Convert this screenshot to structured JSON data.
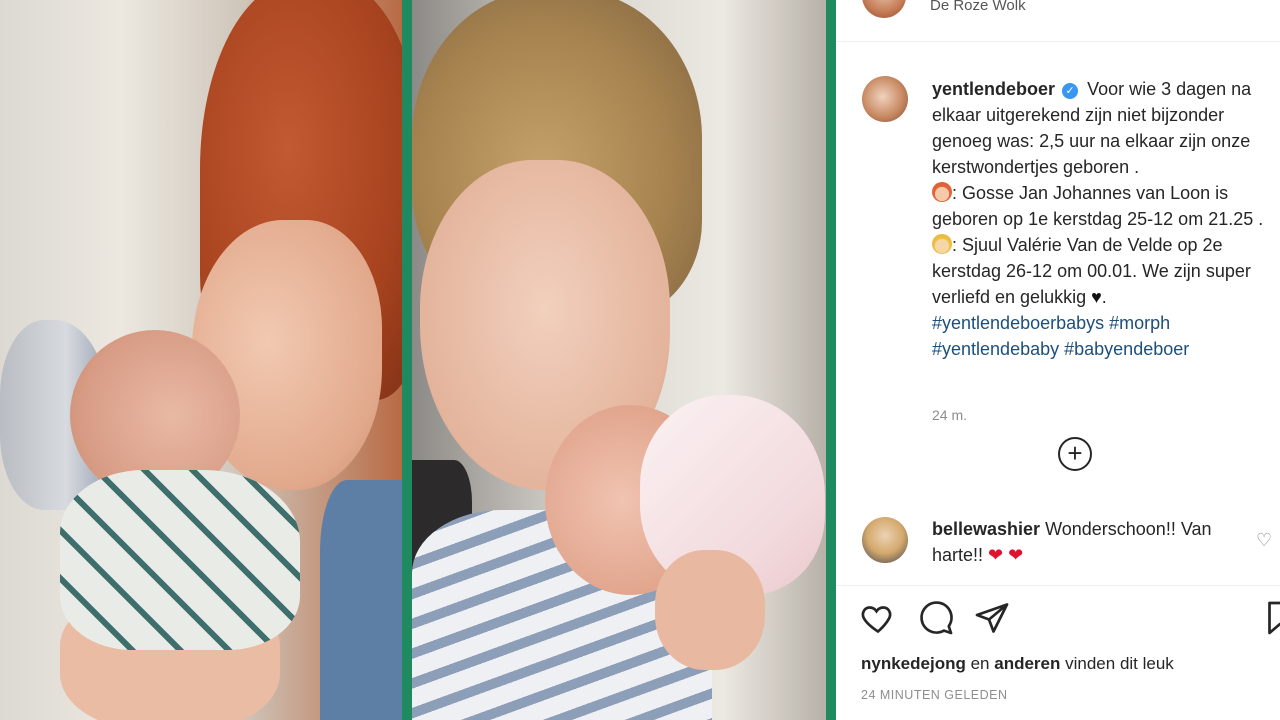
{
  "post": {
    "location": "De Roze Wolk",
    "author": "yentlendeboer",
    "caption_line1": "Voor wie 3 dagen na elkaar uitgerekend zijn niet bijzonder genoeg was: 2,5 uur na elkaar zijn onze kerstwondertjes geboren .",
    "caption_line2": ": Gosse Jan Johannes van Loon is geboren op 1e kerstdag 25-12 om 21.25 .",
    "caption_line3": ": Sjuul Valérie Van de Velde op 2e kerstdag 26-12 om 00.01. We zijn super verliefd en gelukkig",
    "caption_heart": "♥",
    "caption_end": ".",
    "hashtags": [
      "#yentlendeboerbabys",
      "#morph",
      "#yentlendebaby",
      "#babyendeboer"
    ],
    "time_ago": "24 m.",
    "load_more_label": "+"
  },
  "comment": {
    "user": "bellewashier",
    "text": "Wonderschoon!! Van harte!!",
    "hearts": "❤ ❤"
  },
  "likes": {
    "user": "nynkedejong",
    "connector": "en",
    "others": "anderen",
    "suffix": "vinden dit leuk"
  },
  "date_label": "24 MINUTEN GELEDEN",
  "icons": {
    "verified": "verified-badge-icon",
    "like": "heart-icon",
    "comment": "comment-bubble-icon",
    "share": "paper-plane-icon",
    "save": "bookmark-icon",
    "comment_like": "small-heart-icon",
    "load_more": "plus-circle-icon"
  },
  "colors": {
    "divider": "#1f8a5f",
    "verified": "#3897f0",
    "hashtag": "#1d4f7d",
    "heart": "#e0122f"
  }
}
